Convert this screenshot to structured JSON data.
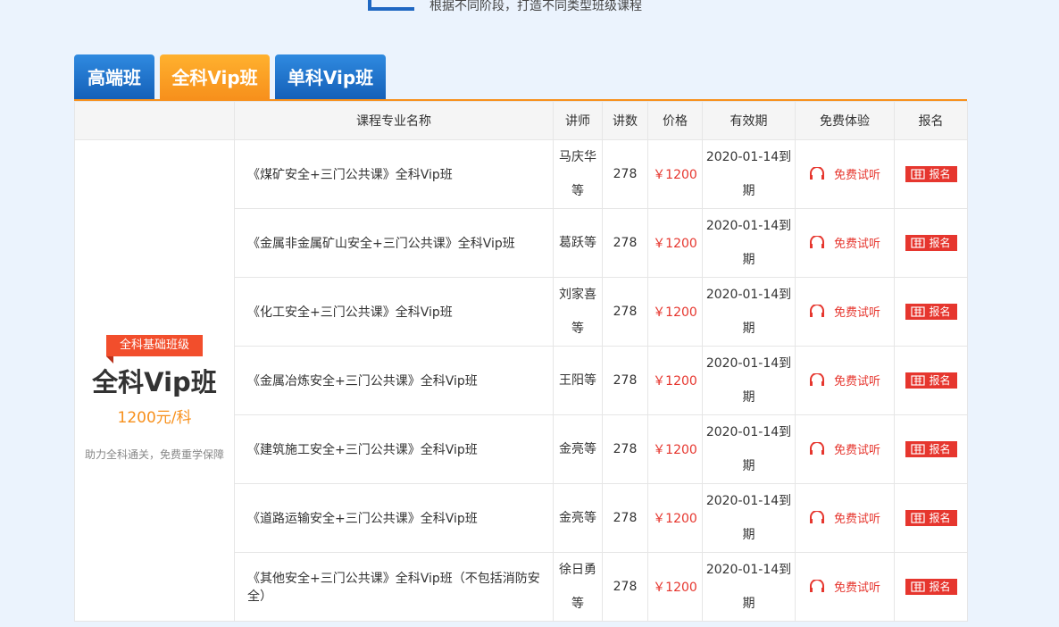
{
  "header": {
    "subtitle": "根据不同阶段，打造不同类型班级课程"
  },
  "tabs": [
    {
      "label": "高端班",
      "color": "#1f6fcb"
    },
    {
      "label": "全科Vip班",
      "color": "#f7901c"
    },
    {
      "label": "单科Vip班",
      "color": "#1f6fcb"
    }
  ],
  "table": {
    "headers": [
      "课程专业名称",
      "讲师",
      "讲数",
      "价格",
      "有效期",
      "免费体验",
      "报名"
    ],
    "rows": [
      {
        "name": "《煤矿安全+三门公共课》全科Vip班",
        "teacher": "马庆华等",
        "lectures": "278",
        "price": "￥1200",
        "expiry": "2020-01-14到期",
        "trial": "免费试听",
        "enroll": "报名"
      },
      {
        "name": "《金属非金属矿山安全+三门公共课》全科Vip班",
        "teacher": "葛跃等",
        "lectures": "278",
        "price": "￥1200",
        "expiry": "2020-01-14到期",
        "trial": "免费试听",
        "enroll": "报名"
      },
      {
        "name": "《化工安全+三门公共课》全科Vip班",
        "teacher": "刘家喜等",
        "lectures": "278",
        "price": "￥1200",
        "expiry": "2020-01-14到期",
        "trial": "免费试听",
        "enroll": "报名"
      },
      {
        "name": "《金属冶炼安全+三门公共课》全科Vip班",
        "teacher": "王阳等",
        "lectures": "278",
        "price": "￥1200",
        "expiry": "2020-01-14到期",
        "trial": "免费试听",
        "enroll": "报名"
      },
      {
        "name": "《建筑施工安全+三门公共课》全科Vip班",
        "teacher": "金亮等",
        "lectures": "278",
        "price": "￥1200",
        "expiry": "2020-01-14到期",
        "trial": "免费试听",
        "enroll": "报名"
      },
      {
        "name": "《道路运输安全+三门公共课》全科Vip班",
        "teacher": "金亮等",
        "lectures": "278",
        "price": "￥1200",
        "expiry": "2020-01-14到期",
        "trial": "免费试听",
        "enroll": "报名"
      },
      {
        "name": "《其他安全+三门公共课》全科Vip班（不包括消防安全）",
        "teacher": "徐日勇等",
        "lectures": "278",
        "price": "￥1200",
        "expiry": "2020-01-14到期",
        "trial": "免费试听",
        "enroll": "报名"
      }
    ]
  },
  "sidebar": {
    "ribbon": "全科基础班级",
    "title": "全科Vip班",
    "price": "1200元/科",
    "desc": "助力全科通关，免费重学保障"
  },
  "icons": {
    "trial": "headphones-icon",
    "enroll": "register-icon"
  },
  "colors": {
    "accent_orange": "#f7901c",
    "accent_blue": "#1f6fcb",
    "price_red": "#e6362e"
  }
}
